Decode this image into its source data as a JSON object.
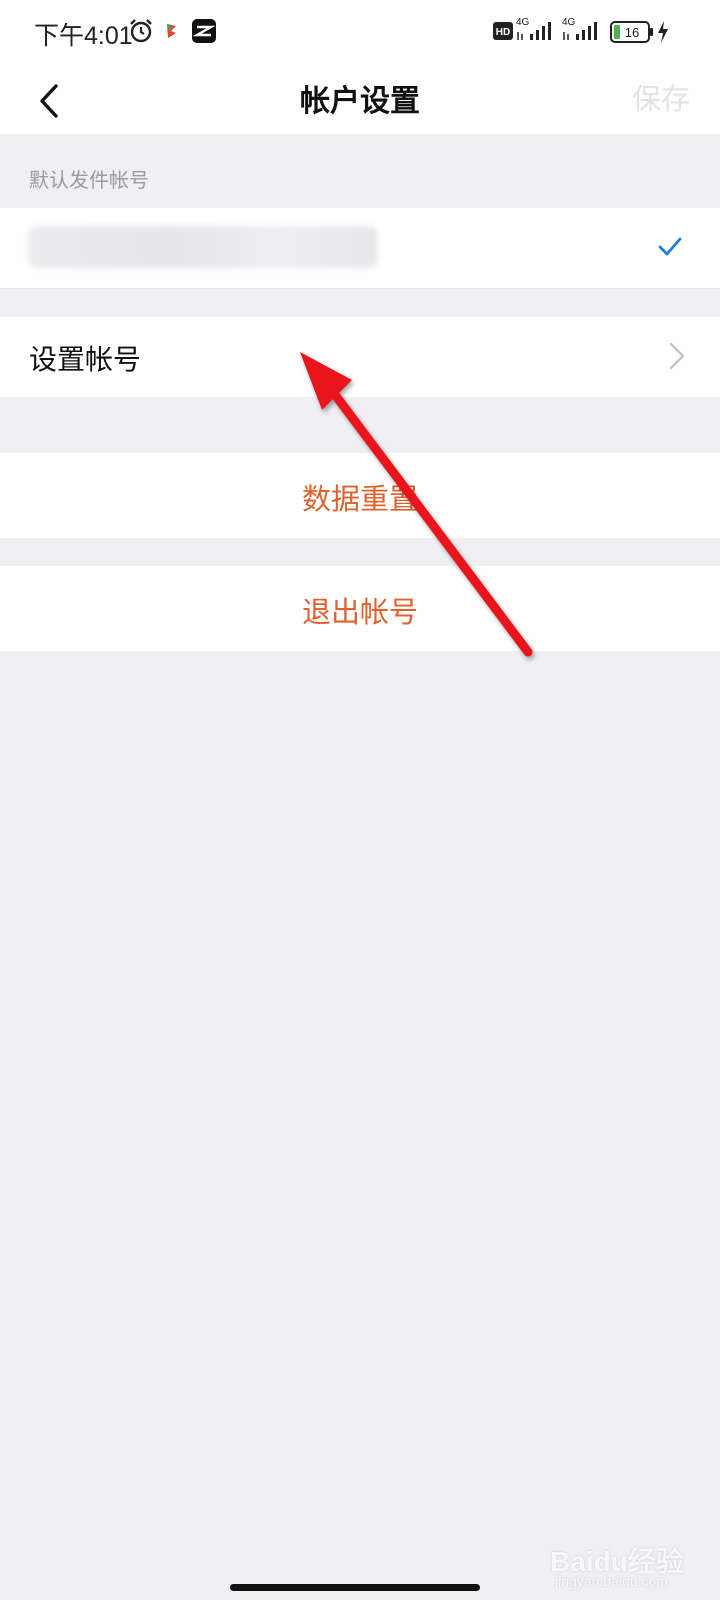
{
  "status_bar": {
    "time": "下午4:01",
    "battery": "16",
    "network_1": "4G",
    "network_2": "4G",
    "hd_badge": "HD",
    "icons": [
      "alarm-icon",
      "app-notification-icon",
      "capcut-icon",
      "hd-icon",
      "signal-icon",
      "battery-icon",
      "charging-icon"
    ]
  },
  "nav": {
    "title": "帐户设置",
    "save_label": "保存",
    "save_color": "#e3e3e3"
  },
  "default_sender": {
    "section_label": "默认发件帐号",
    "account_email": "blurred-email-address",
    "check_color": "#1f7ed6"
  },
  "setup": {
    "label": "设置帐号"
  },
  "actions": {
    "reset_label": "数据重置",
    "logout_label": "退出帐号",
    "action_color": "#e0612d"
  },
  "watermark": {
    "text": "Baidu经验",
    "sub": "jingyan.baidu.com"
  },
  "annotation": {
    "arrow_color": "#e8161b"
  }
}
